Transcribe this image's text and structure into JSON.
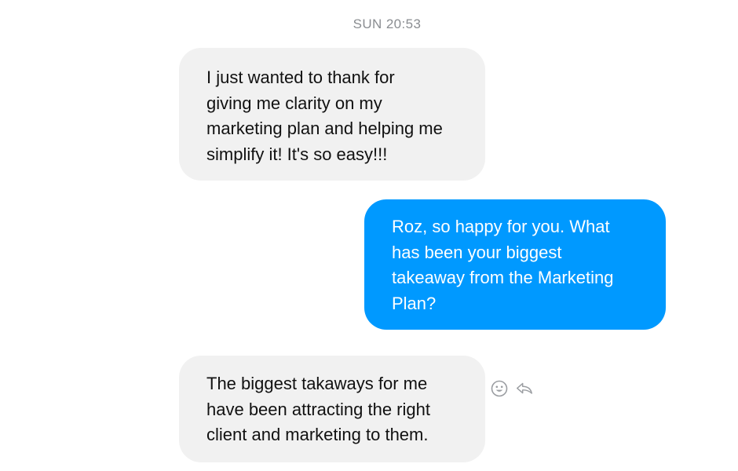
{
  "conversation": {
    "timestamp": "SUN 20:53",
    "messages": [
      {
        "direction": "incoming",
        "text": "I just wanted to thank for\ngiving me clarity on my\nmarketing plan and helping me\nsimplify it! It's so easy!!!"
      },
      {
        "direction": "outgoing",
        "text": "Roz, so happy for you. What\nhas been your biggest\ntakeaway from the Marketing\nPlan?"
      },
      {
        "direction": "incoming",
        "text": "The biggest takaways for me\nhave been attracting the right\nclient and marketing to them."
      }
    ],
    "message_actions": {
      "icons": [
        "smiley-react-icon",
        "reply-icon"
      ]
    }
  },
  "colors": {
    "incoming_bubble": "#f1f1f1",
    "outgoing_bubble": "#0099ff",
    "timestamp_text": "#8a8d91",
    "action_icon": "#9a9da1"
  }
}
